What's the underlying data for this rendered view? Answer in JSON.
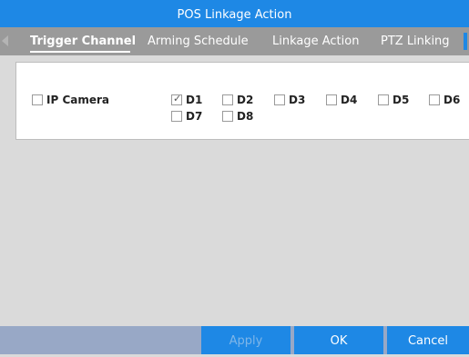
{
  "window": {
    "title": "POS Linkage Action"
  },
  "tabs": [
    {
      "label": "Trigger Channel",
      "active": true
    },
    {
      "label": "Arming Schedule",
      "active": false
    },
    {
      "label": "Linkage Action",
      "active": false
    },
    {
      "label": "PTZ Linking",
      "active": false
    }
  ],
  "ip_camera": {
    "label": "IP Camera",
    "checked": false
  },
  "channels": [
    {
      "label": "D1",
      "checked": true
    },
    {
      "label": "D2",
      "checked": false
    },
    {
      "label": "D3",
      "checked": false
    },
    {
      "label": "D4",
      "checked": false
    },
    {
      "label": "D5",
      "checked": false
    },
    {
      "label": "D6",
      "checked": false
    },
    {
      "label": "D7",
      "checked": false
    },
    {
      "label": "D8",
      "checked": false
    }
  ],
  "check_glyph": "✓",
  "buttons": {
    "apply": "Apply",
    "ok": "OK",
    "cancel": "Cancel"
  },
  "colors": {
    "accent": "#1e88e5",
    "tab_bar": "#9a9a9a",
    "footer": "#98a8c6",
    "background": "#dadada"
  }
}
